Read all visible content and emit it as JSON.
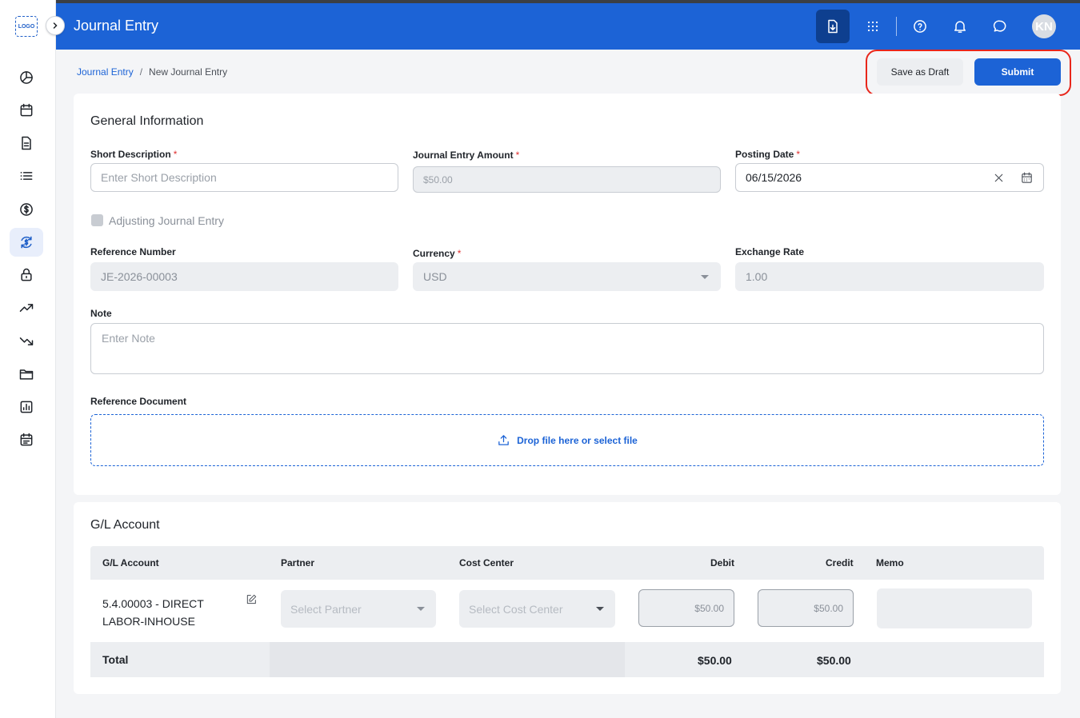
{
  "app": {
    "logo_text": "LOGO",
    "title": "Journal Entry",
    "user_initials": "KN",
    "accent_color": "#1c63d6"
  },
  "rail_icons": [
    "pie-chart-icon",
    "calendar-icon",
    "document-icon",
    "list-icon",
    "dollar-icon",
    "exchange-icon",
    "lock-icon",
    "trending-up-icon",
    "trending-down-icon",
    "folder-icon",
    "report-icon",
    "schedule-icon"
  ],
  "header_icons": [
    "download-doc-icon",
    "apps-grid-icon",
    "help-icon",
    "bell-icon",
    "chat-icon"
  ],
  "breadcrumb": {
    "parent": "Journal Entry",
    "separator": "/",
    "current": "New Journal Entry"
  },
  "actions": {
    "save_draft": "Save as Draft",
    "submit": "Submit"
  },
  "general": {
    "title": "General Information",
    "short_description": {
      "label": "Short Description",
      "placeholder": "Enter Short Description"
    },
    "amount": {
      "label": "Journal Entry Amount",
      "value": "$50.00"
    },
    "posting_date": {
      "label": "Posting Date",
      "value": "06/15/2026"
    },
    "adjusting": {
      "label": "Adjusting Journal Entry",
      "checked": false
    },
    "reference_number": {
      "label": "Reference Number",
      "value": "JE-2026-00003"
    },
    "currency": {
      "label": "Currency",
      "value": "USD"
    },
    "exchange_rate": {
      "label": "Exchange Rate",
      "value": "1.00"
    },
    "note": {
      "label": "Note",
      "placeholder": "Enter Note"
    },
    "reference_document": {
      "label": "Reference Document",
      "dropzone": "Drop file here or select file"
    }
  },
  "gl": {
    "title": "G/L Account",
    "columns": [
      "G/L Account",
      "Partner",
      "Cost Center",
      "Debit",
      "Credit",
      "Memo"
    ],
    "row": {
      "account_line1": "5.4.00003 - DIRECT",
      "account_line2": "LABOR-INHOUSE",
      "partner_placeholder": "Select Partner",
      "cost_center_placeholder": "Select Cost Center",
      "debit": "$50.00",
      "credit": "$50.00",
      "memo": ""
    },
    "total": {
      "label": "Total",
      "debit": "$50.00",
      "credit": "$50.00"
    }
  }
}
